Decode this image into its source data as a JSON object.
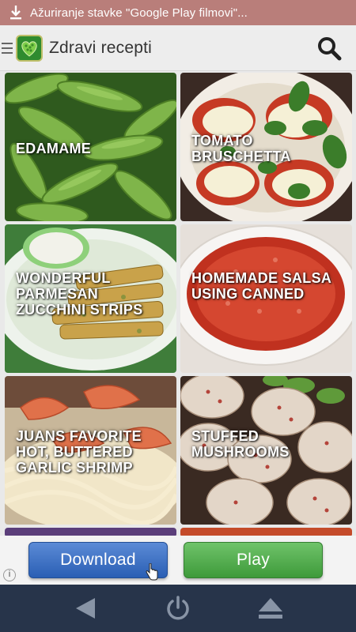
{
  "status_bar": {
    "text": "Ažuriranje stavke \"Google Play filmovi\"...",
    "icon": "download-icon"
  },
  "app_bar": {
    "title": "Zdravi recepti",
    "menu_icon": "hamburger-icon",
    "search_icon": "search-icon"
  },
  "recipes": [
    {
      "title": "EDAMAME"
    },
    {
      "title": "TOMATO BRUSCHETTA"
    },
    {
      "title": "WONDERFUL PARMESAN ZUCCHINI STRIPS"
    },
    {
      "title": "HOMEMADE SALSA USING CANNED"
    },
    {
      "title": "JUANS FAVORITE HOT, BUTTERED GARLIC SHRIMP"
    },
    {
      "title": "STUFFED MUSHROOMS"
    }
  ],
  "ad": {
    "download_label": "Download",
    "play_label": "Play",
    "info_label": "i"
  },
  "nav_bar": {
    "back_icon": "back-icon",
    "power_icon": "power-icon",
    "eject_icon": "eject-icon"
  }
}
